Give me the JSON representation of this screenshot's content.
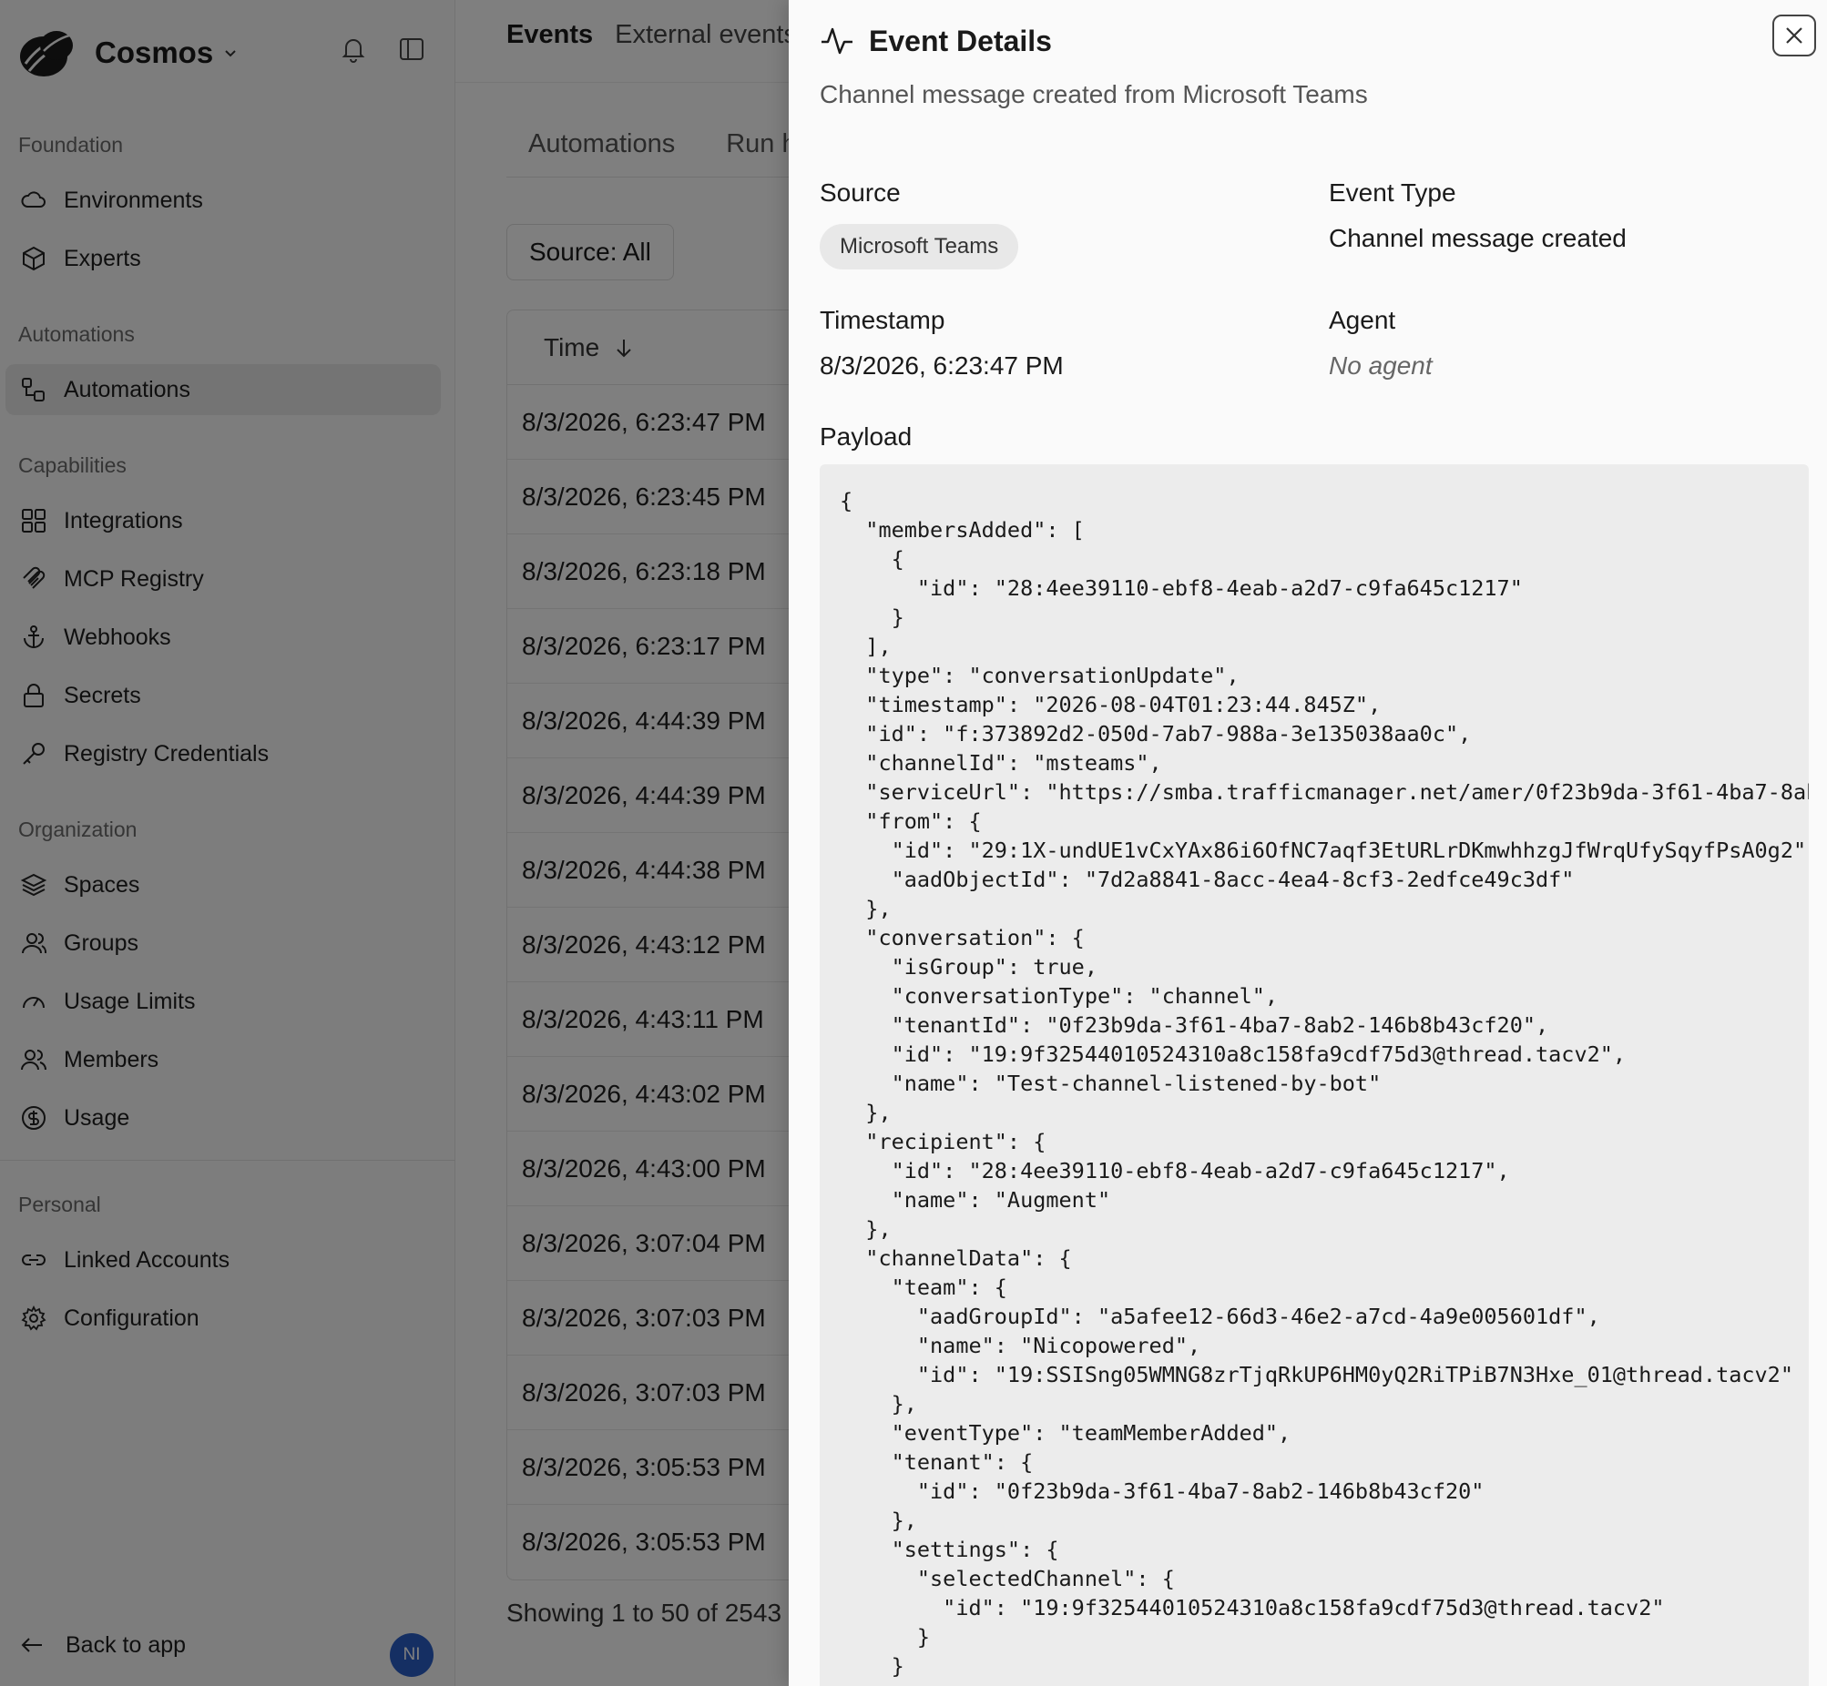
{
  "brand": {
    "name": "Cosmos"
  },
  "sidebar": {
    "sections": [
      {
        "title": "Foundation",
        "items": [
          {
            "label": "Environments",
            "icon": "cloud-icon"
          },
          {
            "label": "Experts",
            "icon": "cube-icon"
          }
        ]
      },
      {
        "title": "Automations",
        "items": [
          {
            "label": "Automations",
            "icon": "workflow-icon",
            "active": true
          }
        ]
      },
      {
        "title": "Capabilities",
        "items": [
          {
            "label": "Integrations",
            "icon": "grid-icon"
          },
          {
            "label": "MCP Registry",
            "icon": "mcp-icon"
          },
          {
            "label": "Webhooks",
            "icon": "anchor-icon"
          },
          {
            "label": "Secrets",
            "icon": "lock-icon"
          },
          {
            "label": "Registry Credentials",
            "icon": "key-icon"
          }
        ]
      },
      {
        "title": "Organization",
        "items": [
          {
            "label": "Spaces",
            "icon": "layers-icon"
          },
          {
            "label": "Groups",
            "icon": "user-icon"
          },
          {
            "label": "Usage Limits",
            "icon": "gauge-icon"
          },
          {
            "label": "Members",
            "icon": "users-icon"
          },
          {
            "label": "Usage",
            "icon": "dollar-icon"
          }
        ]
      },
      {
        "title": "Personal",
        "items": [
          {
            "label": "Linked Accounts",
            "icon": "link-icon"
          },
          {
            "label": "Configuration",
            "icon": "gear-icon"
          }
        ]
      }
    ],
    "back_label": "Back to app",
    "avatar_initials": "NI"
  },
  "main": {
    "tabs": [
      "Events",
      "External events"
    ],
    "sub_tabs": [
      "Automations",
      "Run history"
    ],
    "filter_label": "Source: All",
    "table": {
      "time_header": "Time",
      "rows": [
        "8/3/2026, 6:23:47 PM",
        "8/3/2026, 6:23:45 PM",
        "8/3/2026, 6:23:18 PM",
        "8/3/2026, 6:23:17 PM",
        "8/3/2026, 4:44:39 PM",
        "8/3/2026, 4:44:39 PM",
        "8/3/2026, 4:44:38 PM",
        "8/3/2026, 4:43:12 PM",
        "8/3/2026, 4:43:11 PM",
        "8/3/2026, 4:43:02 PM",
        "8/3/2026, 4:43:00 PM",
        "8/3/2026, 3:07:04 PM",
        "8/3/2026, 3:07:03 PM",
        "8/3/2026, 3:07:03 PM",
        "8/3/2026, 3:05:53 PM",
        "8/3/2026, 3:05:53 PM"
      ]
    },
    "pager_text": "Showing 1 to 50 of 2543"
  },
  "panel": {
    "title": "Event Details",
    "subtitle": "Channel message created from Microsoft Teams",
    "source_label": "Source",
    "source_value": "Microsoft Teams",
    "event_type_label": "Event Type",
    "event_type_value": "Channel message created",
    "timestamp_label": "Timestamp",
    "timestamp_value": "8/3/2026, 6:23:47 PM",
    "agent_label": "Agent",
    "agent_value": "No agent",
    "payload_label": "Payload",
    "payload": "{\n  \"membersAdded\": [\n    {\n      \"id\": \"28:4ee39110-ebf8-4eab-a2d7-c9fa645c1217\"\n    }\n  ],\n  \"type\": \"conversationUpdate\",\n  \"timestamp\": \"2026-08-04T01:23:44.845Z\",\n  \"id\": \"f:373892d2-050d-7ab7-988a-3e135038aa0c\",\n  \"channelId\": \"msteams\",\n  \"serviceUrl\": \"https://smba.trafficmanager.net/amer/0f23b9da-3f61-4ba7-8ab2-146b8b43cf20/\",\n  \"from\": {\n    \"id\": \"29:1X-undUE1vCxYAx86i6OfNC7aqf3EtURLrDKmwhhzgJfWrqUfySqyfPsA0g2\",\n    \"aadObjectId\": \"7d2a8841-8acc-4ea4-8cf3-2edfce49c3df\"\n  },\n  \"conversation\": {\n    \"isGroup\": true,\n    \"conversationType\": \"channel\",\n    \"tenantId\": \"0f23b9da-3f61-4ba7-8ab2-146b8b43cf20\",\n    \"id\": \"19:9f32544010524310a8c158fa9cdf75d3@thread.tacv2\",\n    \"name\": \"Test-channel-listened-by-bot\"\n  },\n  \"recipient\": {\n    \"id\": \"28:4ee39110-ebf8-4eab-a2d7-c9fa645c1217\",\n    \"name\": \"Augment\"\n  },\n  \"channelData\": {\n    \"team\": {\n      \"aadGroupId\": \"a5afee12-66d3-46e2-a7cd-4a9e005601df\",\n      \"name\": \"Nicopowered\",\n      \"id\": \"19:SSISng05WMNG8zrTjqRkUP6HM0yQ2RiTPiB7N3Hxe_01@thread.tacv2\"\n    },\n    \"eventType\": \"teamMemberAdded\",\n    \"tenant\": {\n      \"id\": \"0f23b9da-3f61-4ba7-8ab2-146b8b43cf20\"\n    },\n    \"settings\": {\n      \"selectedChannel\": {\n        \"id\": \"19:9f32544010524310a8c158fa9cdf75d3@thread.tacv2\"\n      }\n    }\n  }\n}"
  },
  "colors": {
    "avatar": "#2b5fc7",
    "active_nav": "#e9e9e9",
    "overlay": "rgba(0,0,0,0.5)",
    "payload_bg": "#ececec"
  }
}
